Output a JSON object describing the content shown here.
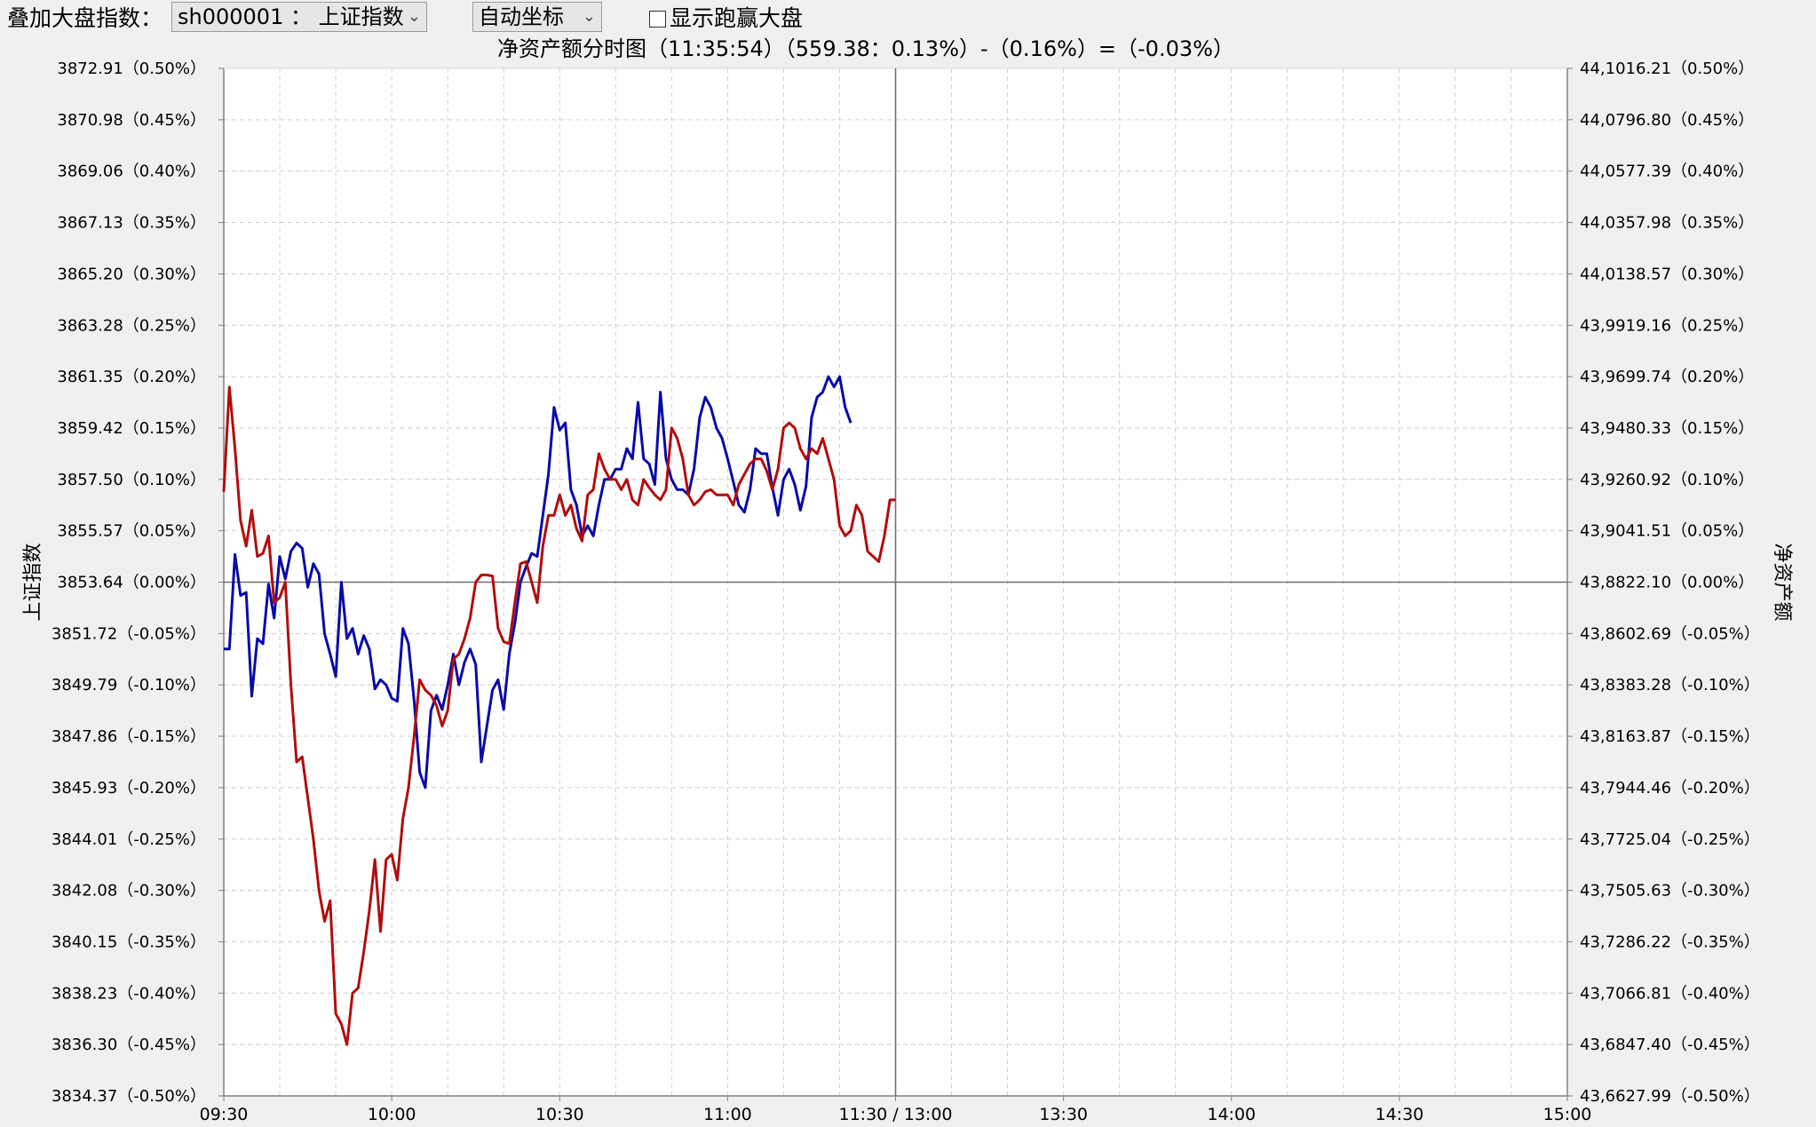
{
  "toolbar": {
    "overlay_label": "叠加大盘指数：",
    "index_select": "sh000001 ： 上证指数",
    "coord_select": "自动坐标",
    "show_outperform_label": "显示跑赢大盘",
    "show_outperform_checked": false
  },
  "chart_title": "净资产额分时图（11:35:54）（559.38：0.13%）-（0.16%）=（-0.03%）",
  "colors": {
    "index_line": "#0a0aa8",
    "nav_line": "#b20d0d",
    "grid": "#cfcfcf",
    "axis": "#808080",
    "background": "#ffffff"
  },
  "chart_data": {
    "type": "line",
    "xlabel": "",
    "ylabel_left": "上证指数",
    "ylabel_right": "净资产额",
    "x_tick_labels": [
      "09:30",
      "10:00",
      "10:30",
      "11:00",
      "11:30 / 13:00",
      "13:30",
      "14:00",
      "14:30",
      "15:00"
    ],
    "x_range_minutes": [
      0,
      240
    ],
    "ylim_pct": [
      -0.5,
      0.5
    ],
    "y_ticks_pct": [
      0.5,
      0.45,
      0.4,
      0.35,
      0.3,
      0.25,
      0.2,
      0.15,
      0.1,
      0.05,
      0.0,
      -0.05,
      -0.1,
      -0.15,
      -0.2,
      -0.25,
      -0.3,
      -0.35,
      -0.4,
      -0.45,
      -0.5
    ],
    "left_tick_labels": [
      "3872.91（0.50%）",
      "3870.98（0.45%）",
      "3869.06（0.40%）",
      "3867.13（0.35%）",
      "3865.20（0.30%）",
      "3863.28（0.25%）",
      "3861.35（0.20%）",
      "3859.42（0.15%）",
      "3857.50（0.10%）",
      "3855.57（0.05%）",
      "3853.64（0.00%）",
      "3851.72（-0.05%）",
      "3849.79（-0.10%）",
      "3847.86（-0.15%）",
      "3845.93（-0.20%）",
      "3844.01（-0.25%）",
      "3842.08（-0.30%）",
      "3840.15（-0.35%）",
      "3838.23（-0.40%）",
      "3836.30（-0.45%）",
      "3834.37（-0.50%）"
    ],
    "right_tick_labels": [
      "44,1016.21（0.50%）",
      "44,0796.80（0.45%）",
      "44,0577.39（0.40%）",
      "44,0357.98（0.35%）",
      "44,0138.57（0.30%）",
      "43,9919.16（0.25%）",
      "43,9699.74（0.20%）",
      "43,9480.33（0.15%）",
      "43,9260.92（0.10%）",
      "43,9041.51（0.05%）",
      "43,8822.10（0.00%）",
      "43,8602.69（-0.05%）",
      "43,8383.28（-0.10%）",
      "43,8163.87（-0.15%）",
      "43,7944.46（-0.20%）",
      "43,7725.04（-0.25%）",
      "43,7505.63（-0.30%）",
      "43,7286.22（-0.35%）",
      "43,7066.81（-0.40%）",
      "43,6847.40（-0.45%）",
      "43,6627.99（-0.50%）"
    ],
    "crosshair_minute": 120,
    "series": [
      {
        "key": "index",
        "x": [
          0,
          1,
          2,
          3,
          4,
          5,
          6,
          7,
          8,
          9,
          10,
          11,
          12,
          13,
          14,
          15,
          16,
          17,
          18,
          19,
          20,
          21,
          22,
          23,
          24,
          25,
          26,
          27,
          28,
          29,
          30,
          31,
          32,
          33,
          34,
          35,
          36,
          37,
          38,
          39,
          40,
          41,
          42,
          43,
          44,
          45,
          46,
          47,
          48,
          49,
          50,
          51,
          52,
          53,
          54,
          55,
          56,
          57,
          58,
          59,
          60,
          61,
          62,
          63,
          64,
          65,
          66,
          67,
          68,
          69,
          70,
          71,
          72,
          73,
          74,
          75,
          76,
          77,
          78,
          79,
          80,
          81,
          82,
          83,
          84,
          85,
          86,
          87,
          88,
          89,
          90,
          91,
          92,
          93,
          94,
          95,
          96,
          97,
          98,
          99,
          100,
          101,
          102,
          103,
          104,
          105,
          106,
          107,
          108,
          109,
          110,
          111,
          112,
          113,
          114,
          115,
          116,
          117,
          118,
          119,
          120
        ],
        "pct": [
          -0.065,
          -0.065,
          0.027,
          -0.013,
          -0.01,
          -0.111,
          -0.055,
          -0.06,
          -0.002,
          -0.035,
          0.025,
          0.003,
          0.03,
          0.038,
          0.033,
          -0.005,
          0.018,
          0.008,
          -0.05,
          -0.07,
          -0.092,
          0.0,
          -0.055,
          -0.045,
          -0.07,
          -0.052,
          -0.065,
          -0.104,
          -0.095,
          -0.1,
          -0.113,
          -0.116,
          -0.045,
          -0.06,
          -0.115,
          -0.185,
          -0.2,
          -0.125,
          -0.11,
          -0.124,
          -0.1,
          -0.07,
          -0.1,
          -0.078,
          -0.065,
          -0.08,
          -0.175,
          -0.14,
          -0.105,
          -0.095,
          -0.124,
          -0.07,
          -0.04,
          0.0,
          0.015,
          0.028,
          0.025,
          0.065,
          0.105,
          0.17,
          0.148,
          0.155,
          0.09,
          0.075,
          0.045,
          0.055,
          0.045,
          0.075,
          0.1,
          0.1,
          0.11,
          0.11,
          0.13,
          0.12,
          0.175,
          0.12,
          0.115,
          0.095,
          0.185,
          0.12,
          0.1,
          0.09,
          0.09,
          0.085,
          0.11,
          0.16,
          0.18,
          0.17,
          0.15,
          0.14,
          0.12,
          0.098,
          0.075,
          0.068,
          0.09,
          0.13,
          0.125,
          0.125,
          0.092,
          0.065,
          0.1,
          0.11,
          0.095,
          0.07,
          0.093,
          0.16,
          0.18,
          0.185,
          0.2,
          0.19,
          0.2,
          0.17,
          0.155
        ],
        "note_units": "percent change vs previous close"
      },
      {
        "key": "nav",
        "x": [
          0,
          1,
          2,
          3,
          4,
          5,
          6,
          7,
          8,
          9,
          10,
          11,
          12,
          13,
          14,
          15,
          16,
          17,
          18,
          19,
          20,
          21,
          22,
          23,
          24,
          25,
          26,
          27,
          28,
          29,
          30,
          31,
          32,
          33,
          34,
          35,
          36,
          37,
          38,
          39,
          40,
          41,
          42,
          43,
          44,
          45,
          46,
          47,
          48,
          49,
          50,
          51,
          52,
          53,
          54,
          55,
          56,
          57,
          58,
          59,
          60,
          61,
          62,
          63,
          64,
          65,
          66,
          67,
          68,
          69,
          70,
          71,
          72,
          73,
          74,
          75,
          76,
          77,
          78,
          79,
          80,
          81,
          82,
          83,
          84,
          85,
          86,
          87,
          88,
          89,
          90,
          91,
          92,
          93,
          94,
          95,
          96,
          97,
          98,
          99,
          100,
          101,
          102,
          103,
          104,
          105,
          106,
          107,
          108,
          109,
          110,
          111,
          112,
          113,
          114,
          115,
          116,
          117,
          118,
          119,
          120
        ],
        "pct": [
          0.088,
          0.19,
          0.13,
          0.06,
          0.035,
          0.07,
          0.025,
          0.028,
          0.045,
          -0.02,
          -0.015,
          0.0,
          -0.1,
          -0.175,
          -0.17,
          -0.21,
          -0.25,
          -0.3,
          -0.33,
          -0.31,
          -0.42,
          -0.43,
          -0.45,
          -0.4,
          -0.395,
          -0.36,
          -0.32,
          -0.27,
          -0.34,
          -0.27,
          -0.265,
          -0.29,
          -0.23,
          -0.2,
          -0.15,
          -0.095,
          -0.105,
          -0.11,
          -0.12,
          -0.14,
          -0.125,
          -0.075,
          -0.07,
          -0.055,
          -0.035,
          0.0,
          0.007,
          0.007,
          0.006,
          -0.045,
          -0.058,
          -0.06,
          -0.02,
          0.018,
          0.02,
          0.0,
          -0.02,
          0.035,
          0.065,
          0.065,
          0.085,
          0.065,
          0.075,
          0.052,
          0.04,
          0.085,
          0.09,
          0.125,
          0.11,
          0.1,
          0.1,
          0.09,
          0.1,
          0.08,
          0.075,
          0.1,
          0.092,
          0.085,
          0.08,
          0.09,
          0.15,
          0.14,
          0.12,
          0.085,
          0.075,
          0.08,
          0.088,
          0.09,
          0.085,
          0.085,
          0.085,
          0.075,
          0.095,
          0.105,
          0.115,
          0.12,
          0.12,
          0.108,
          0.09,
          0.11,
          0.15,
          0.155,
          0.15,
          0.13,
          0.12,
          0.13,
          0.125,
          0.14,
          0.12,
          0.1,
          0.055,
          0.045,
          0.05,
          0.075,
          0.065,
          0.03,
          0.025,
          0.02,
          0.045,
          0.08,
          0.08
        ],
        "note_units": "percent change vs previous close"
      }
    ]
  }
}
